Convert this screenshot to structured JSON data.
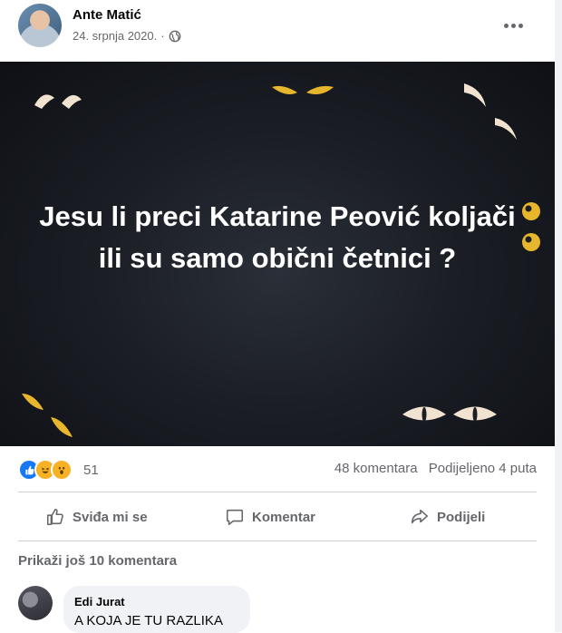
{
  "post": {
    "author": "Ante Matić",
    "date": "24. srpnja 2020.",
    "separator": "·",
    "headline": "Jesu li preci Katarine Peović koljači ili su samo obični četnici ?",
    "reaction_count": "51",
    "comment_count": "48 komentara",
    "share_count": "Podijeljeno 4 puta"
  },
  "actions": {
    "like": "Sviđa mi se",
    "comment": "Komentar",
    "share": "Podijeli"
  },
  "comments": {
    "more_label": "Prikaži još 10 komentara",
    "items": [
      {
        "name": "Edi Jurat",
        "text": "A KOJA JE TU RAZLIKA"
      }
    ]
  },
  "colors": {
    "like_blue": "#1877f2",
    "reaction_yellow": "#f7b125",
    "secondary_text": "#65676b",
    "image_bg": "#1b1e25",
    "eye_cream": "#f1e3cf",
    "eye_yellow": "#e8b62c"
  }
}
